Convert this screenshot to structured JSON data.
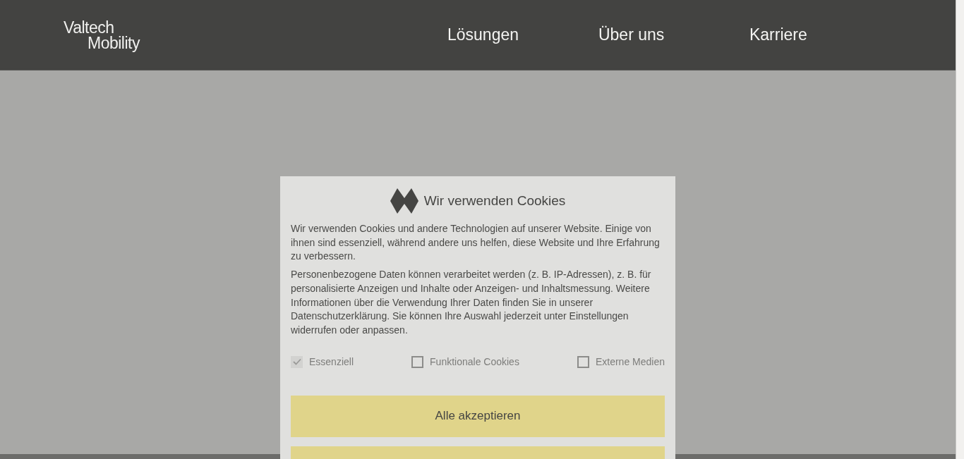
{
  "header": {
    "logo": [
      "Valtech",
      "Mobility"
    ],
    "nav": [
      "Lösungen",
      "Über uns",
      "Karriere"
    ]
  },
  "cookie_dialog": {
    "title": "Wir verwenden Cookies",
    "paragraphs": [
      "Wir verwenden Cookies und andere Technologien auf unserer Website. Einige von ihnen sind essenziell, während andere uns helfen, diese Website und Ihre Erfahrung zu verbessern.",
      "Personenbezogene Daten können verarbeitet werden (z. B. IP-Adressen), z. B. für personalisierte Anzeigen und Inhalte oder Anzeigen- und Inhaltsmessung. Weitere Informationen über die Verwendung Ihrer Daten finden Sie in unserer Datenschutzerklärung. Sie können Ihre Auswahl jederzeit unter Einstellungen widerrufen oder anpassen."
    ],
    "options": [
      {
        "label": "Essenziell",
        "checked": true,
        "disabled": true
      },
      {
        "label": "Funktionale Cookies",
        "checked": false,
        "disabled": false
      },
      {
        "label": "Externe Medien",
        "checked": false,
        "disabled": false
      }
    ],
    "primary_button": "Alle akzeptieren"
  }
}
